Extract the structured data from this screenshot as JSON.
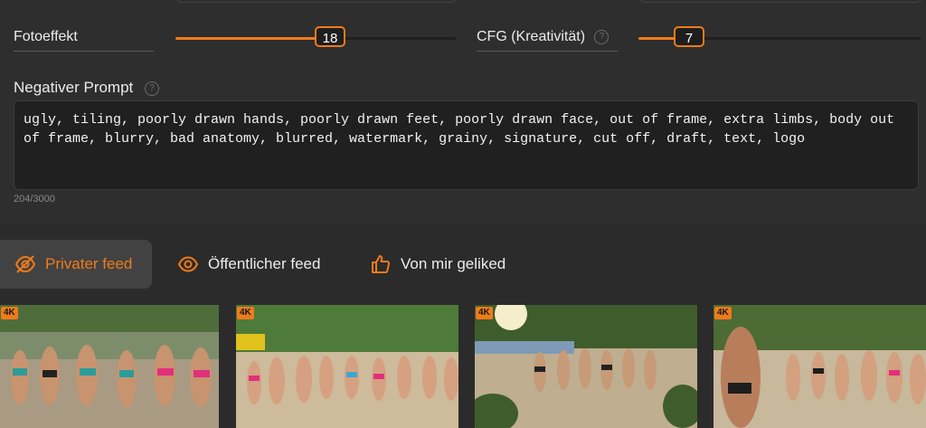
{
  "sliders": [
    {
      "label": "Fotoeffekt",
      "value": "18",
      "fraction": 0.55,
      "has_help": false
    },
    {
      "label": "CFG (Kreativität)",
      "value": "7",
      "fraction": 0.18,
      "has_help": true
    }
  ],
  "negative_prompt": {
    "title": "Negativer Prompt",
    "text": "ugly, tiling, poorly drawn hands, poorly drawn feet, poorly drawn face, out of frame, extra limbs, body out of frame, blurry, bad anatomy, blurred, watermark, grainy, signature, cut off, draft, text, logo",
    "counter": "204/3000"
  },
  "tabs": [
    {
      "label": "Privater feed",
      "icon": "eye-off-icon",
      "active": true
    },
    {
      "label": "Öffentlicher feed",
      "icon": "eye-icon",
      "active": false
    },
    {
      "label": "Von mir geliked",
      "icon": "thumbs-up-icon",
      "active": false
    }
  ],
  "gallery": [
    {
      "badge": "4K"
    },
    {
      "badge": "4K"
    },
    {
      "badge": "4K"
    },
    {
      "badge": "4K"
    }
  ],
  "colors": {
    "accent": "#ef7b1a",
    "background": "#2b2b2b",
    "field": "#202020"
  }
}
